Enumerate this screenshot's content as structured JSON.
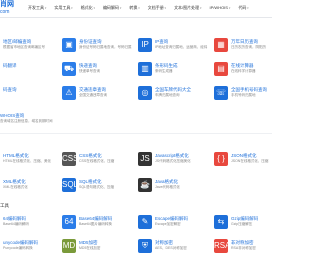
{
  "nav": {
    "logo_title": "肖网",
    "logo_sub": "com",
    "items": [
      "开发工具",
      "实用工具",
      "格式化",
      "编码解码",
      "转换",
      "文档手册",
      "文本/图片处理",
      "IP/WHOIS",
      "代码"
    ]
  },
  "tools": [
    {
      "title": "地区/邮编查询",
      "desc": "根据省市地区查询邮编区号",
      "color": "#1e6fd9",
      "glyph": "✉"
    },
    {
      "title": "身份证查询",
      "desc": "身份证号码归属地查询，号码归属",
      "color": "#2b7de9",
      "glyph": "▣"
    },
    {
      "title": "IP查询",
      "desc": "IP地址查询归属地、运营商、经纬",
      "color": "#1e6fd9",
      "glyph": "IP"
    },
    {
      "title": "万年日历查询",
      "desc": "日历农历查询，阴阳历",
      "color": "#e8483e",
      "glyph": "▦"
    },
    {
      "title": "码翻译",
      "desc": "",
      "color": "#1e6fd9",
      "glyph": "⇄"
    },
    {
      "title": "快递查询",
      "desc": "快递单号查询",
      "color": "#2b7de9",
      "glyph": "⛟"
    },
    {
      "title": "条形码生成",
      "desc": "条码生成器",
      "color": "#1e6fd9",
      "glyph": "▥"
    },
    {
      "title": "在线计算器",
      "desc": "在线科学计算器",
      "color": "#e8483e",
      "glyph": "▤"
    },
    {
      "title": "码查询",
      "desc": "",
      "color": "#1e6fd9",
      "glyph": "☎"
    },
    {
      "title": "交通违章查询",
      "desc": "全国交通违章查询",
      "color": "#2b7de9",
      "glyph": "⚠"
    },
    {
      "title": "全国车牌代码大全",
      "desc": "车牌归属地查询",
      "color": "#1e6fd9",
      "glyph": "◎"
    },
    {
      "title": "全国手机号码查询",
      "desc": "手机号码归属地",
      "color": "#1e6fd9",
      "glyph": "☏"
    }
  ],
  "standalone": {
    "title": "WHOIS查询",
    "desc": "查询域名注册信息，域名到期时间"
  },
  "format_section": "",
  "format_tools": [
    {
      "title": "HTML格式化",
      "desc": "HTML在线格式化、压缩、美化",
      "color": "#2b7de9",
      "glyph": "<>"
    },
    {
      "title": "CSS格式化",
      "desc": "CSS在线格式化、压缩",
      "color": "#555555",
      "glyph": "CSS"
    },
    {
      "title": "Javascript格式化",
      "desc": "JS代码格式化压缩美化",
      "color": "#333333",
      "glyph": "JS"
    },
    {
      "title": "JSON格式化",
      "desc": "JSON在线格式化、压缩",
      "color": "#e8483e",
      "glyph": "{ }"
    },
    {
      "title": "XML格式化",
      "desc": "XML在线格式化",
      "color": "#2b7de9",
      "glyph": "XML"
    },
    {
      "title": "SQL格式化",
      "desc": "SQL语句格式化、压缩",
      "color": "#1e6fd9",
      "glyph": "SQL"
    },
    {
      "title": "Java格式化",
      "desc": "Java代码格式化",
      "color": "#333333",
      "glyph": "☕"
    }
  ],
  "codec_section": "工具",
  "codec_tools": [
    {
      "title": "64编码解码",
      "desc": "Base64编码解码",
      "color": "#2b7de9",
      "glyph": "64"
    },
    {
      "title": "Base64编码解码",
      "desc": "Base64图片编码转换",
      "color": "#2b7de9",
      "glyph": "64"
    },
    {
      "title": "Escape编码解码",
      "desc": "Escape加密解密",
      "color": "#1e6fd9",
      "glyph": "✎"
    },
    {
      "title": "Gzip编码解码",
      "desc": "Gzip压缩解压",
      "color": "#1e6fd9",
      "glyph": "⇆"
    },
    {
      "title": "unycode编码解码",
      "desc": "Punycode编码转换",
      "color": "#2b7de9",
      "glyph": "P"
    },
    {
      "title": "MD5加密",
      "desc": "MD5在线加密",
      "color": "#7a9a3a",
      "glyph": "MD"
    },
    {
      "title": "对称加密",
      "desc": "AES、DES对称加密",
      "color": "#1e6fd9",
      "glyph": "⛨"
    },
    {
      "title": "非对称加密",
      "desc": "RSA非对称加密",
      "color": "#e8483e",
      "glyph": "RSA"
    }
  ]
}
